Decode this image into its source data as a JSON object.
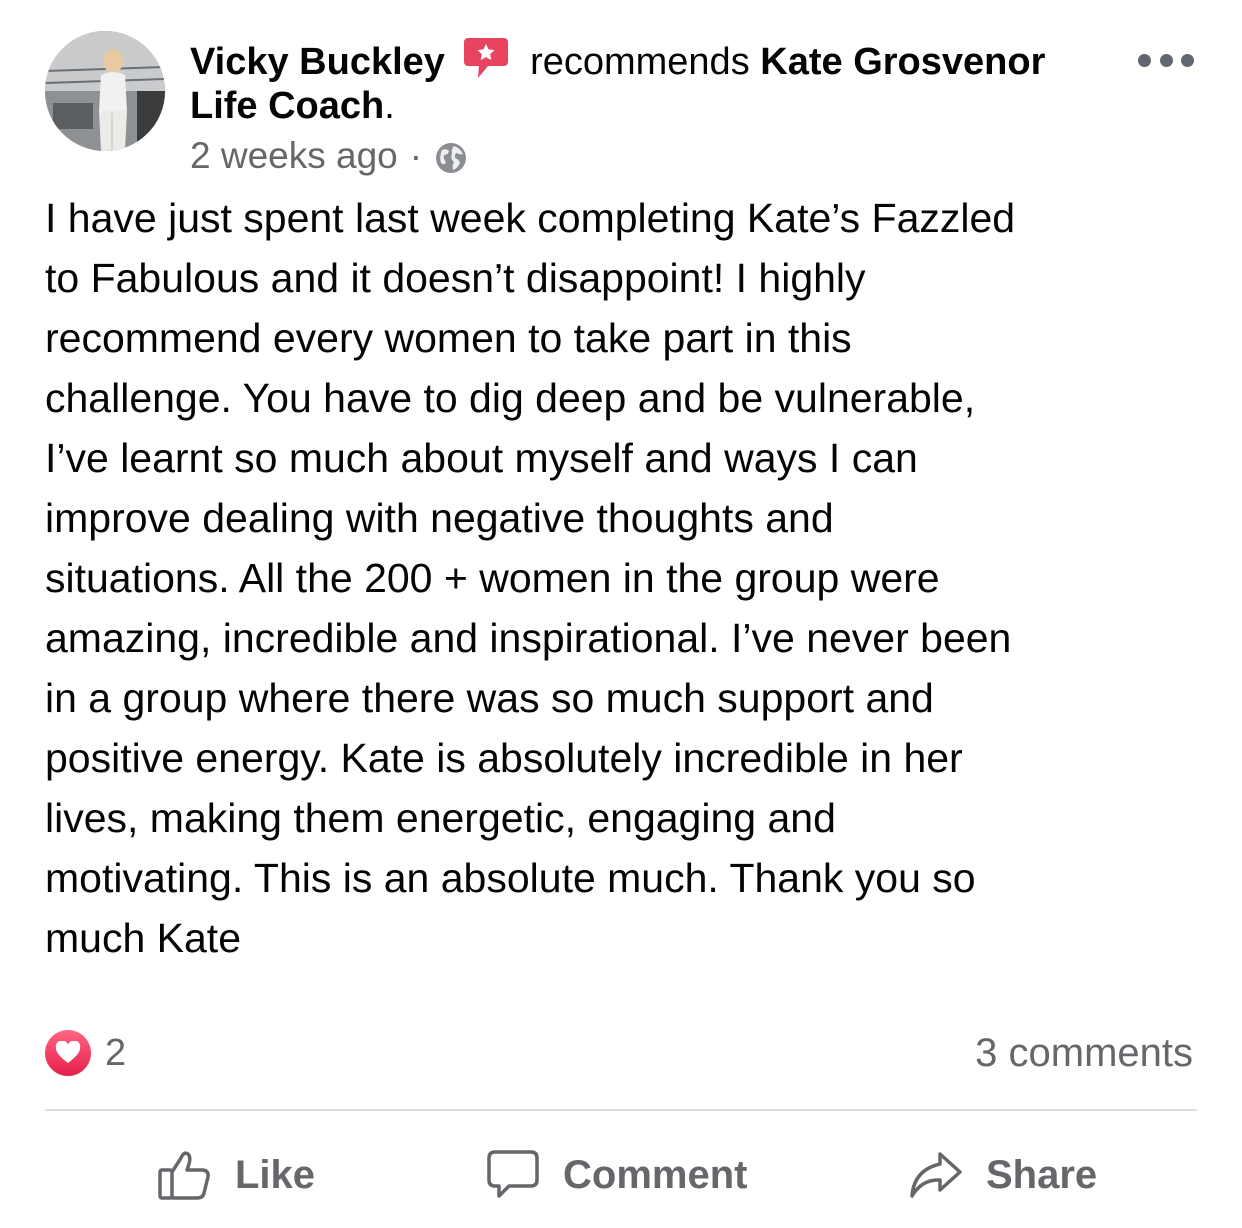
{
  "post": {
    "author": "Vicky Buckley",
    "action_text": "recommends",
    "page_name": "Kate Grosvenor Life Coach",
    "page_suffix": ".",
    "timestamp": "2 weeks ago",
    "separator": "·",
    "body": "I have just spent last week completing Kate’s Fazzled\nto Fabulous and it doesn’t disappoint!  I highly\nrecommend every  women to take part in this\nchallenge.  You have to dig deep and be vulnerable,\nI’ve learnt so much about myself and ways I can\nimprove dealing with negative thoughts and\nsituations.   All the 200 + women in the group were\namazing, incredible and inspirational.  I’ve never been\nin a group where there was so much support and\npositive energy.  Kate is absolutely incredible in her\nlives, making them energetic, engaging and\nmotivating.  This is an absolute much.  Thank you so\nmuch Kate"
  },
  "stats": {
    "reaction_count": "2",
    "comments_label": "3 comments"
  },
  "actions": {
    "like": "Like",
    "comment": "Comment",
    "share": "Share"
  },
  "icons": {
    "recommend": "recommend-star-icon",
    "audience": "globe-icon",
    "more": "more-options-icon",
    "reaction": "heart-icon",
    "like": "thumbs-up-icon",
    "comment": "comment-bubble-icon",
    "share": "share-arrow-icon"
  },
  "colors": {
    "recommend_accent": "#e8435f",
    "heart": "#f02849",
    "secondary_text": "#65676b",
    "divider": "#dadde1"
  }
}
